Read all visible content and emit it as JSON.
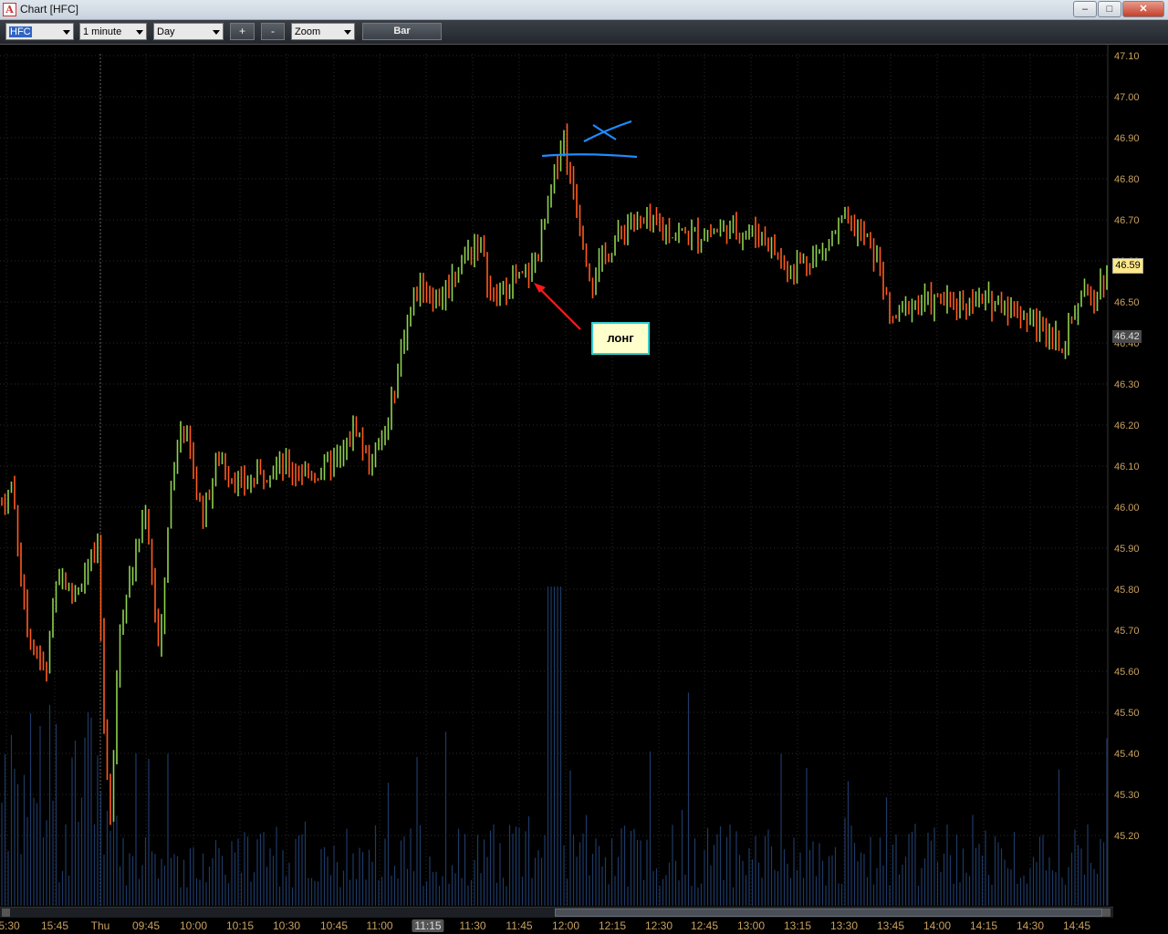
{
  "window": {
    "title": "Chart [HFC]",
    "icon": "app-logo-icon",
    "app_glyph": "A",
    "minimize": "–",
    "maximize": "□",
    "close": "✕"
  },
  "toolbar": {
    "symbol": "HFC",
    "interval": "1 minute",
    "range": "Day",
    "zoom_in": "+",
    "zoom_out": "-",
    "zoom_mode": "Zoom",
    "chart_style": "Bar"
  },
  "annotations": {
    "long_label": "лонг",
    "last_price": "46.59",
    "cursor_price": "46.42",
    "cursor_time": "11:15"
  },
  "colors": {
    "up": "#8fd14f",
    "down": "#ff5a1f",
    "volume": "#1e3a66",
    "grid": "#2a2a2a",
    "axis_text": "#c8a060",
    "pen_blue": "#1e8cff",
    "pen_red": "#ff1a1a"
  },
  "chart_data": {
    "type": "bar",
    "symbol": "HFC",
    "interval": "1 minute",
    "y_ticks": [
      "47.10",
      "47.00",
      "46.90",
      "46.80",
      "46.70",
      "46.60",
      "46.50",
      "46.40",
      "46.30",
      "46.20",
      "46.10",
      "46.00",
      "45.90",
      "45.80",
      "45.70",
      "45.60",
      "45.50",
      "45.40",
      "45.30",
      "45.20"
    ],
    "x_ticks": [
      "5:30",
      "15:45",
      "Thu",
      "09:45",
      "10:00",
      "10:15",
      "10:30",
      "10:45",
      "11:00",
      "11:15",
      "11:30",
      "11:45",
      "12:00",
      "12:15",
      "12:30",
      "12:45",
      "13:00",
      "13:15",
      "13:30",
      "13:45",
      "14:00",
      "14:15",
      "14:30",
      "14:45"
    ],
    "ylim": [
      45.1,
      47.1
    ],
    "last_price": 46.59,
    "close_path": [
      [
        0,
        46.0
      ],
      [
        14,
        46.05
      ],
      [
        28,
        45.72
      ],
      [
        50,
        45.58
      ],
      [
        62,
        45.85
      ],
      [
        80,
        45.78
      ],
      [
        108,
        45.9
      ],
      [
        113,
        45.5
      ],
      [
        122,
        45.22
      ],
      [
        130,
        45.7
      ],
      [
        150,
        45.9
      ],
      [
        160,
        46.0
      ],
      [
        175,
        45.62
      ],
      [
        185,
        46.0
      ],
      [
        198,
        46.22
      ],
      [
        210,
        46.1
      ],
      [
        222,
        45.98
      ],
      [
        240,
        46.12
      ],
      [
        265,
        46.05
      ],
      [
        300,
        46.1
      ],
      [
        345,
        46.08
      ],
      [
        375,
        46.12
      ],
      [
        390,
        46.2
      ],
      [
        405,
        46.1
      ],
      [
        425,
        46.2
      ],
      [
        445,
        46.45
      ],
      [
        460,
        46.55
      ],
      [
        480,
        46.5
      ],
      [
        505,
        46.6
      ],
      [
        525,
        46.65
      ],
      [
        540,
        46.5
      ],
      [
        560,
        46.55
      ],
      [
        578,
        46.56
      ],
      [
        590,
        46.62
      ],
      [
        605,
        46.78
      ],
      [
        617,
        46.92
      ],
      [
        625,
        46.8
      ],
      [
        635,
        46.7
      ],
      [
        648,
        46.55
      ],
      [
        660,
        46.6
      ],
      [
        690,
        46.7
      ],
      [
        720,
        46.68
      ],
      [
        760,
        46.66
      ],
      [
        800,
        46.68
      ],
      [
        840,
        46.66
      ],
      [
        860,
        46.58
      ],
      [
        900,
        46.62
      ],
      [
        925,
        46.7
      ],
      [
        950,
        46.65
      ],
      [
        965,
        46.58
      ],
      [
        975,
        46.45
      ],
      [
        1000,
        46.5
      ],
      [
        1050,
        46.5
      ],
      [
        1100,
        46.5
      ],
      [
        1140,
        46.44
      ],
      [
        1165,
        46.4
      ],
      [
        1180,
        46.5
      ],
      [
        1200,
        46.52
      ],
      [
        1215,
        46.59
      ]
    ]
  },
  "time_axis_labels": [
    {
      "text": "5:30"
    },
    {
      "text": "15:45"
    },
    {
      "text": "Thu"
    },
    {
      "text": "09:45"
    },
    {
      "text": "10:00"
    },
    {
      "text": "10:15"
    },
    {
      "text": "10:30"
    },
    {
      "text": "10:45"
    },
    {
      "text": "11:00"
    },
    {
      "text": "11:30"
    },
    {
      "text": "11:45"
    },
    {
      "text": "12:00"
    },
    {
      "text": "12:15"
    },
    {
      "text": "12:30"
    },
    {
      "text": "12:45"
    },
    {
      "text": "13:00"
    },
    {
      "text": "13:15"
    },
    {
      "text": "13:30"
    },
    {
      "text": "13:45"
    },
    {
      "text": "14:00"
    },
    {
      "text": "14:15"
    },
    {
      "text": "14:30"
    },
    {
      "text": "14:45"
    }
  ]
}
